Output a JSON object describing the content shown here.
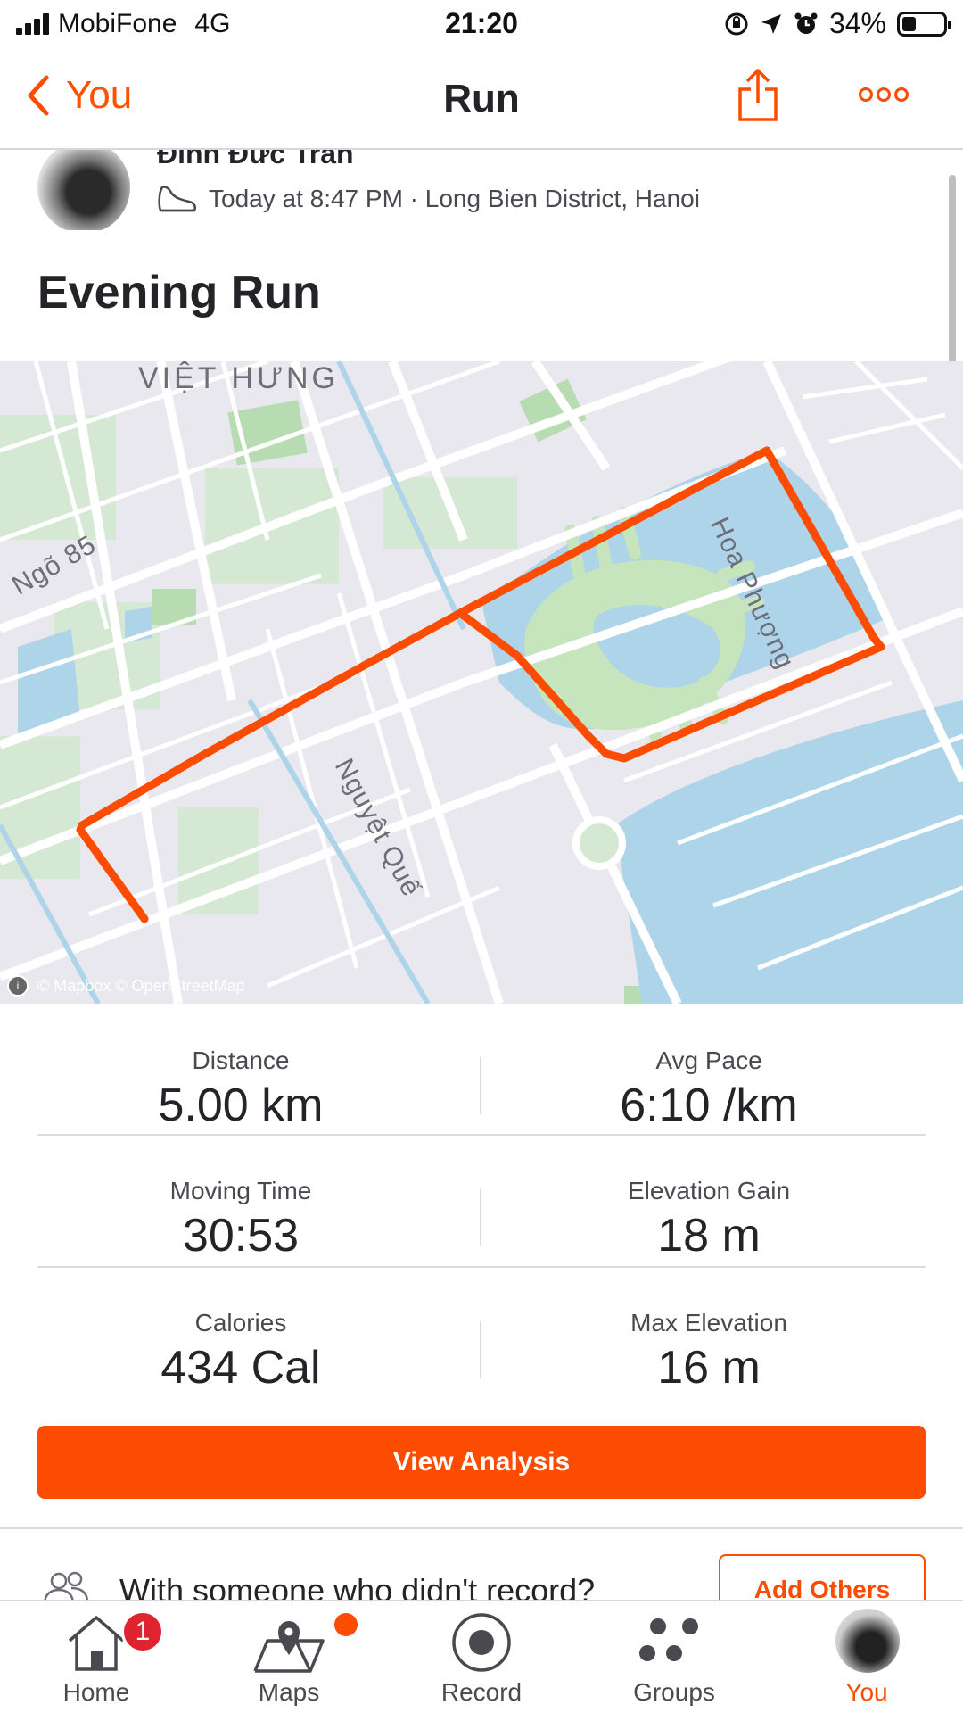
{
  "status_bar": {
    "carrier": "MobiFone",
    "network": "4G",
    "time": "21:20",
    "battery_percent": "34%",
    "battery_level": 0.34,
    "icons": [
      "signal-icon",
      "screen-rotation-lock-icon",
      "location-arrow-icon",
      "alarm-icon",
      "battery-icon"
    ]
  },
  "nav": {
    "back_label": "You",
    "title": "Run",
    "icons": [
      "chevron-left-icon",
      "share-icon",
      "more-icon"
    ]
  },
  "athlete": {
    "name": "Đinh Đức Trần",
    "meta": "Today at 8:47 PM · Long Bien District, Hanoi"
  },
  "activity": {
    "title": "Evening Run"
  },
  "map": {
    "labels": {
      "viet_hung": "VIỆT HƯNG",
      "ngo85": "Ngõ 85",
      "hoa_phuong": "Hoa Phượng",
      "nguyet_que": "Nguyệt Quế"
    },
    "attribution": "© Mapbox © OpenStreetMap",
    "route_color": "#fc4c02"
  },
  "stats": [
    {
      "left": {
        "label": "Distance",
        "value": "5.00 km"
      },
      "right": {
        "label": "Avg Pace",
        "value": "6:10 /km"
      }
    },
    {
      "left": {
        "label": "Moving Time",
        "value": "30:53"
      },
      "right": {
        "label": "Elevation Gain",
        "value": "18 m"
      }
    },
    {
      "left": {
        "label": "Calories",
        "value": "434 Cal"
      },
      "right": {
        "label": "Max Elevation",
        "value": "16 m"
      }
    }
  ],
  "actions": {
    "view_analysis": "View Analysis",
    "with_someone": "With someone who didn't record?",
    "add_others": "Add Others"
  },
  "tabs": [
    {
      "label": "Home",
      "badge": "1"
    },
    {
      "label": "Maps"
    },
    {
      "label": "Record"
    },
    {
      "label": "Groups"
    },
    {
      "label": "You"
    }
  ],
  "colors": {
    "accent": "#fc4c02",
    "badge_red": "#e0242f",
    "text": "#242428"
  }
}
